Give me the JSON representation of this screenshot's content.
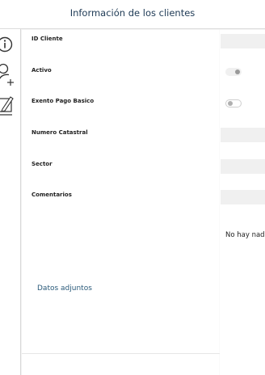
{
  "window": {
    "title": "Información de los clientes"
  },
  "sidebar": {
    "icons": [
      "info-icon",
      "add-user-icon",
      "edit-icon"
    ]
  },
  "form": {
    "fields": {
      "id_cliente": {
        "label": "ID Cliente",
        "value": ""
      },
      "activo": {
        "label": "Activo",
        "checked": true
      },
      "exento": {
        "label": "Exento Pago Basico",
        "checked": false
      },
      "catastral": {
        "label": "Numero Catastral",
        "value": ""
      },
      "sector": {
        "label": "Sector",
        "value": ""
      },
      "comentarios": {
        "label": "Comentarios",
        "value": ""
      }
    }
  },
  "empty_message": "No hay nad",
  "attachments_label": "Datos adjuntos",
  "colors": {
    "title": "#1e3a55",
    "link": "#2a5a7a",
    "background": "#f3f3f3"
  }
}
